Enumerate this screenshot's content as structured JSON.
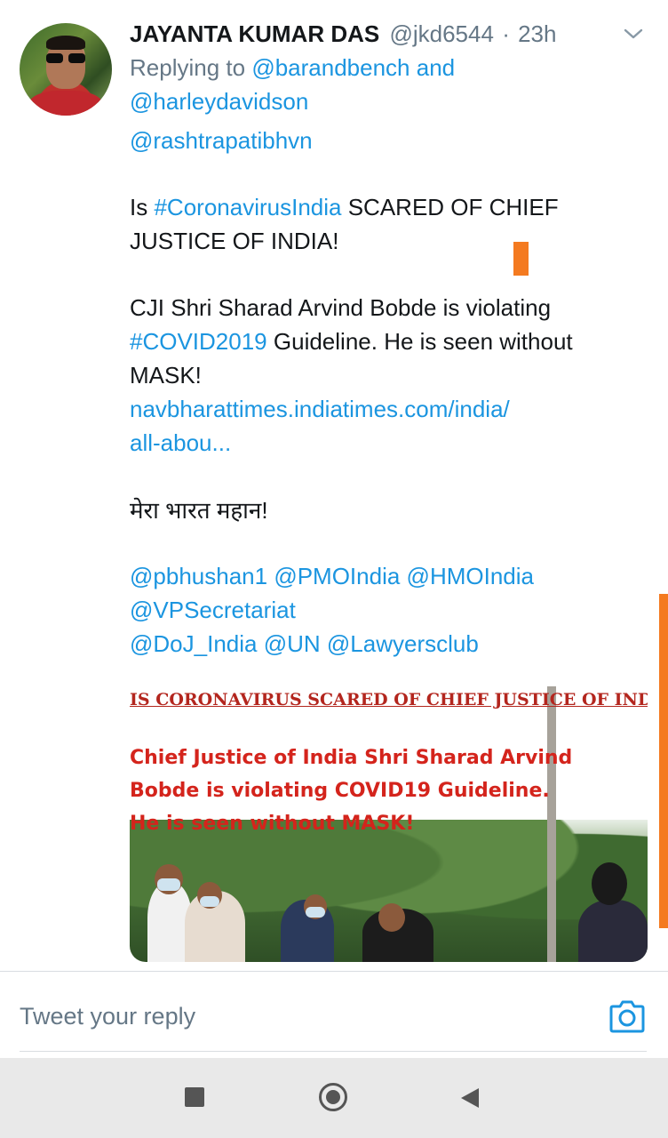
{
  "tweet": {
    "author": {
      "name": "JAYANTA KUMAR DAS",
      "handle": "@jkd6544",
      "separator": "·",
      "time": "23h"
    },
    "replying": {
      "prefix": "Replying to",
      "mention_1": "@barandbench",
      "conjunction": "and",
      "mention_2": "@harleydavidson"
    },
    "mention_line": "@rashtrapatibhvn",
    "para1": {
      "pre": "Is",
      "hashtag": "#CoronavirusIndia",
      "post": "SCARED OF CHIEF JUSTICE OF INDIA!"
    },
    "para2": {
      "line1": "CJI Shri Sharad Arvind Bobde is violating",
      "hashtag": "#COVID2019",
      "line2_post": "Guideline. He is seen without MASK!",
      "link_line1": "navbharattimes.indiatimes.com/india/",
      "link_line2": "all-abou..."
    },
    "hindi": "मेरा भारत महान!",
    "mentions": {
      "line1": [
        "@pbhushan1",
        "@PMOIndia",
        "@HMOIndia"
      ],
      "line2": [
        "@VPSecretariat"
      ],
      "line3": [
        "@DoJ_India",
        "@UN",
        "@Lawyersclub"
      ]
    },
    "media": {
      "headline": "IS CORONAVIRUS SCARED OF CHIEF JUSTICE OF INDIA?",
      "body_line1": "Chief Justice of India Shri Sharad Arvind",
      "body_line2": "Bobde is violating COVID19 Guideline.",
      "body_line3": "He is seen without MASK!"
    }
  },
  "reply": {
    "placeholder": "Tweet your reply"
  },
  "icons": {
    "more": "chevron-down-icon",
    "camera": "camera-icon",
    "nav_recents": "square-icon",
    "nav_home": "circle-icon",
    "nav_back": "triangle-back-icon"
  },
  "colors": {
    "link": "#1b95e0",
    "muted": "#657786",
    "text": "#14171a",
    "accent_orange": "#f47a20",
    "media_red": "#d4241c"
  }
}
